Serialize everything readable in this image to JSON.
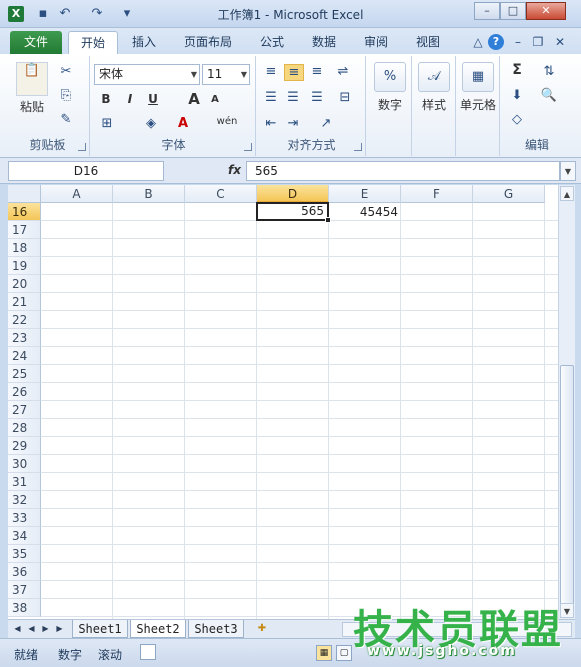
{
  "window": {
    "title": "工作簿1 - Microsoft Excel",
    "app_icon": "X"
  },
  "quick_access": [
    "save-icon",
    "undo-icon",
    "redo-icon",
    "customize-icon"
  ],
  "ribbon_tabs": {
    "file": "文件",
    "items": [
      "开始",
      "插入",
      "页面布局",
      "公式",
      "数据",
      "审阅",
      "视图"
    ],
    "active": "开始"
  },
  "ribbon": {
    "clipboard": {
      "label": "剪贴板",
      "paste": "粘贴"
    },
    "font": {
      "label": "字体",
      "font_name": "宋体",
      "font_size": "11",
      "bold": "B",
      "italic": "I",
      "underline": "U",
      "grow": "A",
      "shrink": "A",
      "wen": "wén"
    },
    "alignment": {
      "label": "对齐方式"
    },
    "number": {
      "label": "数字",
      "percent": "%"
    },
    "styles": {
      "label": "样式"
    },
    "cells": {
      "label": "单元格"
    },
    "editing": {
      "label": "编辑",
      "sigma": "Σ"
    }
  },
  "formula_bar": {
    "name_box": "D16",
    "fx": "fx",
    "value": "565"
  },
  "grid": {
    "columns": [
      "A",
      "B",
      "C",
      "D",
      "E",
      "F",
      "G"
    ],
    "selected_column": "D",
    "rows": [
      "16",
      "17",
      "18",
      "19",
      "20",
      "21",
      "22",
      "23",
      "24",
      "25",
      "26",
      "27",
      "28",
      "29",
      "30",
      "31",
      "32",
      "33",
      "34",
      "35",
      "36",
      "37",
      "38"
    ],
    "selected_row": "16",
    "cells": {
      "D16": "565",
      "E16": "45454"
    }
  },
  "sheet_tabs": [
    "Sheet1",
    "Sheet2",
    "Sheet3"
  ],
  "active_sheet": "Sheet2",
  "status_bar": {
    "ready": "就绪",
    "num": "数字",
    "scroll": "滚动"
  },
  "watermark": {
    "text": "技术员联盟",
    "url": "www.jsgho.com"
  }
}
